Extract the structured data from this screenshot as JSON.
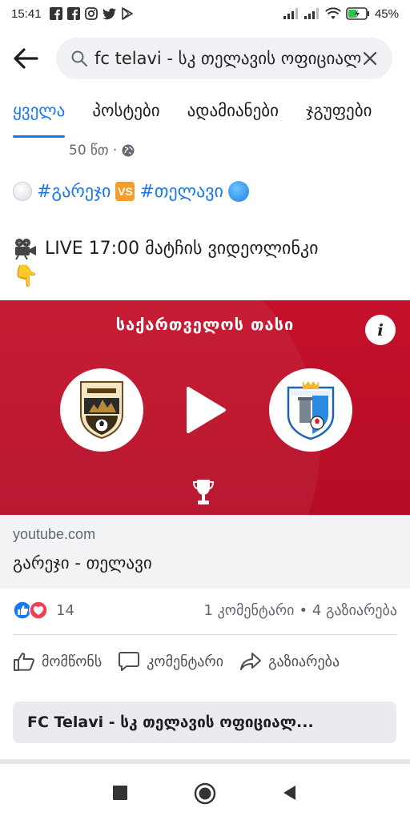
{
  "status_bar": {
    "time": "15:41",
    "battery": "45%",
    "notification_icons": [
      "facebook-icon",
      "facebook-icon",
      "instagram-icon",
      "twitter-icon",
      "play-store-icon"
    ]
  },
  "search": {
    "query": "fc telavi - სკ თელავის ოფიციალური"
  },
  "tabs": [
    {
      "label": "ყველა",
      "active": true
    },
    {
      "label": "პოსტები",
      "active": false
    },
    {
      "label": "ადამიანები",
      "active": false
    },
    {
      "label": "ჯგუფები",
      "active": false
    }
  ],
  "post": {
    "time_ago": "50 წთ ·",
    "hashtag_1": "#გარეჯი",
    "vs_badge": "VS",
    "hashtag_2": "#თელავი",
    "line_2": "LIVE 17:00 მატჩის ვიდეოლინკი",
    "point_emoji": "👇"
  },
  "video": {
    "banner_title": "საქართველოს თასი",
    "info_label": "i"
  },
  "link": {
    "domain": "youtube.com",
    "title": "გარეჯი - თელავი"
  },
  "reactions": {
    "count": "14",
    "comments": "1 კომენტარი",
    "shares": "• 4 გაზიარება"
  },
  "actions": {
    "like": "მომწონს",
    "comment": "კომენტარი",
    "share": "გაზიარება"
  },
  "group": {
    "name": "FC Telavi - სკ თელავის ოფიციალ..."
  },
  "colors": {
    "accent": "#1877f2",
    "banner_red": "#c4102b"
  }
}
